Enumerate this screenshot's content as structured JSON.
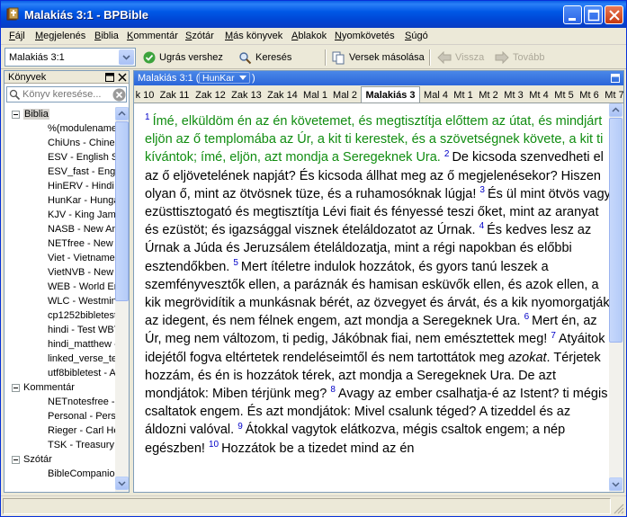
{
  "window": {
    "title": "Malakiás 3:1 - BPBible",
    "colors": {
      "titlebar": "#0058e6",
      "accent_green": "#118d11",
      "verse_number": "#0000c8"
    }
  },
  "menu": {
    "items": [
      "Fájl",
      "Megjelenés",
      "Biblia",
      "Kommentár",
      "Szótár",
      "Más könyvek",
      "Ablakok",
      "Nyomkövetés",
      "Súgó"
    ]
  },
  "toolbar": {
    "reference_value": "Malakiás 3:1",
    "goto_label": "Ugrás vershez",
    "search_label": "Keresés",
    "copy_label": "Versek másolása",
    "back_label": "Vissza",
    "forward_label": "Tovább"
  },
  "left_pane": {
    "title": "Könyvek",
    "search_placeholder": "Könyv keresése...",
    "groups": [
      {
        "label": "Biblia",
        "items": [
          "%(modulename",
          "ChiUns - Chines",
          "ESV - English St",
          "ESV_fast - Engli",
          "HinERV - Hindi E",
          "HunKar - Hunga",
          "KJV - King Jame",
          "NASB - New Am",
          "NETfree - New I",
          "Viet - Vietnames",
          "VietNVB - New V",
          "WEB - World En",
          "WLC - Westmins",
          "cp1252bibletest",
          "hindi - Test WBT",
          "hindi_matthew -",
          "linked_verse_te",
          "utf8bibletest - A"
        ]
      },
      {
        "label": "Kommentár",
        "items": [
          "NETnotesfree -",
          "Personal - Perso",
          "Rieger - Carl He",
          "TSK - Treasury"
        ]
      },
      {
        "label": "Szótár",
        "items": [
          "BibleCompanion"
        ]
      }
    ]
  },
  "right_pane": {
    "header_title": "Malakiás 3:1 (",
    "module_label": "HunKar",
    "header_suffix": ")",
    "tabs": [
      "k 10",
      "Zak 11",
      "Zak 12",
      "Zak 13",
      "Zak 14",
      "Mal 1",
      "Mal 2",
      "Malakiás 3",
      "Mal 4",
      "Mt 1",
      "Mt 2",
      "Mt 3",
      "Mt 4",
      "Mt 5",
      "Mt 6",
      "Mt 7"
    ],
    "active_tab": "Malakiás 3",
    "verses": [
      {
        "n": "1",
        "text": "Ímé, elküldöm én az én követemet, és megtisztítja előttem az útat, és mindjárt eljön az ő templomába az Úr, a kit ti kerestek, és a szövetségnek követe, a kit ti kívántok; ímé, eljön, azt mondja a Seregeknek Ura.",
        "highlight": true
      },
      {
        "n": "2",
        "text": "De kicsoda szenvedheti el az ő eljövetelének napját? És kicsoda állhat meg az ő megjelenésekor? Hiszen olyan ő, mint az ötvösnek tüze, és a ruhamosóknak lúgja!"
      },
      {
        "n": "3",
        "text": "És ül mint ötvös vagy ezüsttisztogató és megtisztítja Lévi fiait és fényessé teszi őket, mint az aranyat és ezüstöt; és igazsággal visznek ételáldozatot az Úrnak."
      },
      {
        "n": "4",
        "text": "És kedves lesz az Úrnak a Júda és Jeruzsálem ételáldozatja, mint a régi napokban és előbbi esztendőkben."
      },
      {
        "n": "5",
        "text": "Mert ítéletre indulok hozzátok, és gyors tanú leszek a szemfényvesztők ellen, a paráznák és hamisan esküvők ellen, és azok ellen, a kik megrövidítik a munkásnak bérét, az özvegyet és árvát, és a kik nyomorgatják az idegent, és nem félnek engem, azt mondja a Seregeknek Ura."
      },
      {
        "n": "6",
        "text": "Mert én, az Úr, meg nem változom, ti pedig, Jákóbnak fiai, nem emésztettek meg!"
      },
      {
        "n": "7",
        "text": "Atyáitok idejétől fogva eltértetek rendeléseimtől és nem tartottátok meg ",
        "italic": "azokat",
        "text_after": ". Térjetek hozzám, és én is hozzátok térek, azt mondja a Seregeknek Ura. De azt mondjátok: Miben térjünk meg?"
      },
      {
        "n": "8",
        "text": "Avagy az ember csalhatja-é az Istent? ti mégis csaltatok engem. És azt mondjátok: Mivel csalunk téged? A tizeddel és az áldozni valóval."
      },
      {
        "n": "9",
        "text": "Átokkal vagytok elátkozva, mégis csaltok engem; a nép egészben!"
      },
      {
        "n": "10",
        "text": "Hozzátok be a tizedet mind az én"
      }
    ]
  }
}
